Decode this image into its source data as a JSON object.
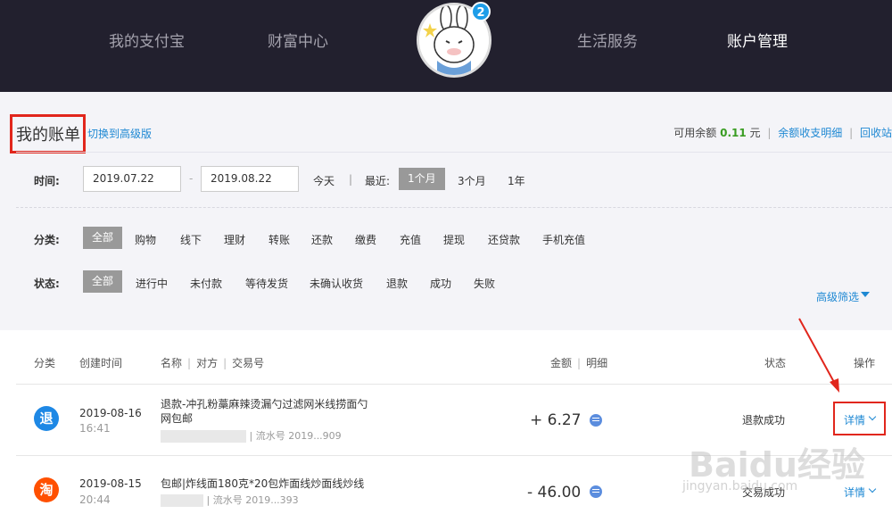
{
  "nav": {
    "items": [
      "我的支付宝",
      "财富中心",
      "生活服务",
      "账户管理"
    ],
    "badge_count": "2"
  },
  "header": {
    "title": "我的账单",
    "switch_link": "切换到高级版",
    "balance_label": "可用余额",
    "balance_amount": "0.11",
    "balance_unit": "元",
    "balance_detail_link": "余额收支明细",
    "recycle_link": "回收站"
  },
  "filters": {
    "time_label": "时间:",
    "date_from": "2019.07.22",
    "date_sep": "-",
    "date_to": "2019.08.22",
    "today": "今天",
    "divider": "|",
    "recent_label": "最近:",
    "recent_options": [
      "1个月",
      "3个月",
      "1年"
    ],
    "category_label": "分类:",
    "categories": [
      "全部",
      "购物",
      "线下",
      "理财",
      "转账",
      "还款",
      "缴费",
      "充值",
      "提现",
      "还贷款",
      "手机充值"
    ],
    "status_label": "状态:",
    "statuses": [
      "全部",
      "进行中",
      "未付款",
      "等待发货",
      "未确认收货",
      "退款",
      "成功",
      "失败"
    ],
    "advanced": "高级筛选"
  },
  "table": {
    "headers": {
      "category": "分类",
      "created": "创建时间",
      "name": "名称",
      "counterparty": "对方",
      "trade_no": "交易号",
      "amount": "金额",
      "detail": "明细",
      "status": "状态",
      "action": "操作"
    },
    "rows": [
      {
        "icon_text": "退",
        "icon_color": "#1e88e5",
        "date": "2019-08-16",
        "time": "16:41",
        "name": "退款-冲孔粉藁麻辣烫漏勺过滤网米线捞面勺网包邮",
        "sub_suffix": "| 流水号 2019...909",
        "amount": "+ 6.27",
        "status": "退款成功",
        "action": "详情"
      },
      {
        "icon_text": "淘",
        "icon_color": "#ff5000",
        "date": "2019-08-15",
        "time": "20:44",
        "name": "包邮|炸线面180克*20包炸面线炒面线炒线",
        "sub_suffix": "| 流水号 2019...393",
        "amount": "- 46.00",
        "status": "交易成功",
        "action": "详情"
      }
    ]
  },
  "watermark": {
    "main": "Baidu经验",
    "sub": "jingyan.baidu.com"
  }
}
